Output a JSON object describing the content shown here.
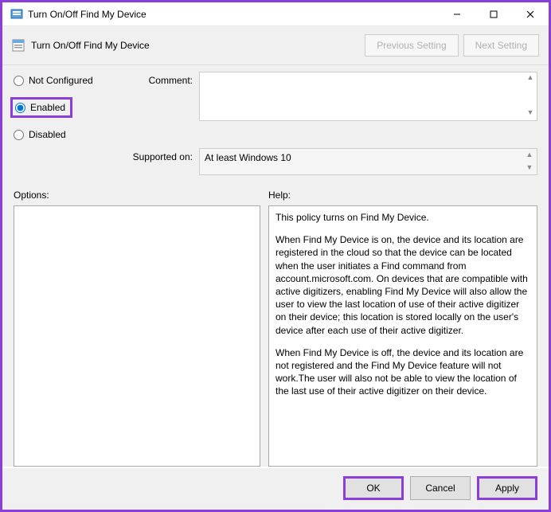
{
  "window": {
    "title": "Turn On/Off Find My Device"
  },
  "toolbar": {
    "title": "Turn On/Off Find My Device",
    "prev": "Previous Setting",
    "next": "Next Setting"
  },
  "state": {
    "not_configured": "Not Configured",
    "enabled": "Enabled",
    "disabled": "Disabled",
    "selected": "enabled"
  },
  "labels": {
    "comment": "Comment:",
    "supported_on": "Supported on:",
    "options": "Options:",
    "help": "Help:"
  },
  "comment": "",
  "supported_on": "At least Windows 10",
  "help": {
    "p1": "This policy turns on Find My Device.",
    "p2": "When Find My Device is on, the device and its location are registered in the cloud so that the device can be located when the user initiates a Find command from account.microsoft.com. On devices that are compatible with active digitizers, enabling Find My Device will also allow the user to view the last location of use of their active digitizer on their device; this location is stored locally on the user's device after each use of their active digitizer.",
    "p3": "When Find My Device is off, the device and its location are not registered and the Find My Device feature will not work.The user will also not be able to view the location of the last use of their active digitizer on their device."
  },
  "footer": {
    "ok": "OK",
    "cancel": "Cancel",
    "apply": "Apply"
  }
}
